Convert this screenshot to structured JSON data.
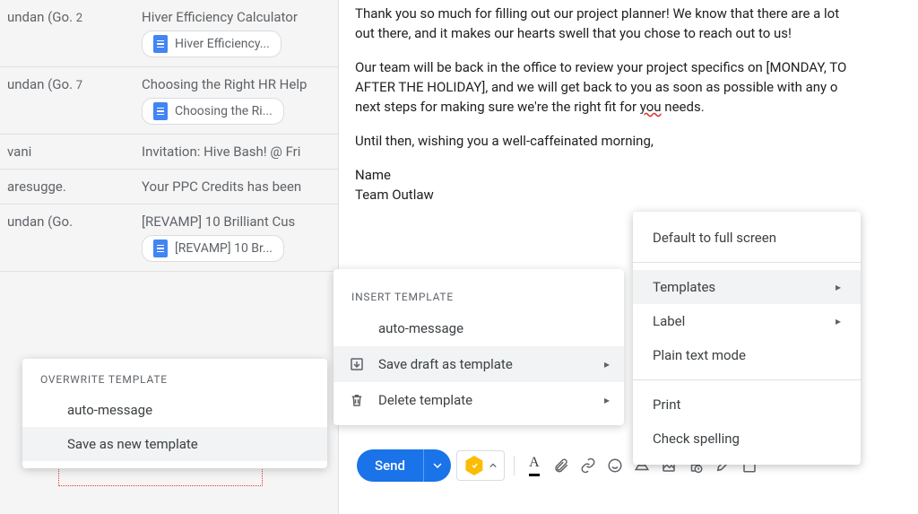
{
  "email_list": [
    {
      "sender": "undan (Go.",
      "count": "2",
      "subject": "Hiver Efficiency Calculator",
      "chip": "Hiver Efficiency..."
    },
    {
      "sender": "undan (Go.",
      "count": "7",
      "subject": "Choosing the Right HR Help",
      "chip": "Choosing the Ri..."
    },
    {
      "sender": "vani",
      "count": "",
      "subject": "Invitation: Hive Bash! @ Fri",
      "chip": null
    },
    {
      "sender": "aresugge.",
      "count": "",
      "subject": "Your PPC Credits has been",
      "chip": null
    },
    {
      "sender": "undan (Go.",
      "count": "",
      "subject": "[REVAMP] 10 Brilliant Cus",
      "chip": "[REVAMP] 10 Br..."
    }
  ],
  "overwrite_menu": {
    "header": "OVERWRITE TEMPLATE",
    "items": [
      "auto-message",
      "Save as new template"
    ]
  },
  "compose": {
    "para1a": "Thank you so much for filling out our project planner! We know that there are a lot",
    "para1b": "out there, and it makes our hearts swell that you chose to reach out to us!",
    "para2a": "Our team will be back in the office to review your project specifics on [MONDAY, TO",
    "para2b": "AFTER THE HOLIDAY], and we will get back to you as soon as possible with any o",
    "para2c_pre": "next steps for making sure we're the right fit for ",
    "para2c_you": "you",
    "para2c_post": " needs.",
    "para3": "Until then, wishing you a well-caffeinated morning,",
    "sig1": "Name",
    "sig2": "Team Outlaw"
  },
  "templates_menu": {
    "header": "INSERT TEMPLATE",
    "item1": "auto-message",
    "item2": "Save draft as template",
    "item3": "Delete template"
  },
  "more_menu": {
    "item1": "Default to full screen",
    "item2": "Templates",
    "item3": "Label",
    "item4": "Plain text mode",
    "item5": "Print",
    "item6": "Check spelling"
  },
  "toolbar": {
    "send": "Send"
  }
}
